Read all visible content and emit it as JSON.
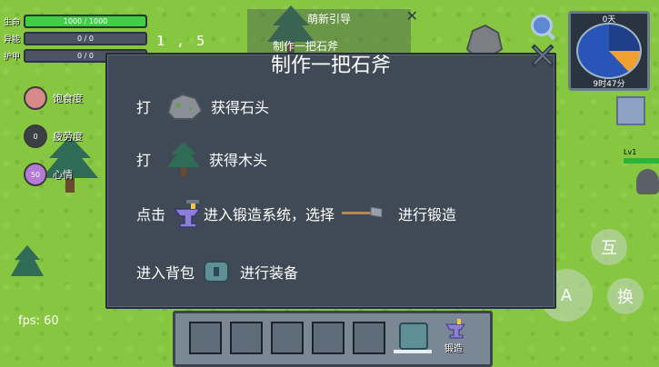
{
  "hud": {
    "hp_label": "生命",
    "hp_value": "1000 / 1000",
    "energy_label": "异能",
    "energy_value": "0 / 0",
    "armor_label": "护甲",
    "armor_value": "0 / 0",
    "coords": "1 , 5",
    "fps": "fps: 60"
  },
  "status": [
    {
      "label": "饱食度",
      "icon": "food-icon",
      "value": "",
      "color": "#d88a8a"
    },
    {
      "label": "疲劳度",
      "icon": "fatigue-icon",
      "value": "0",
      "color": "#3b3f46"
    },
    {
      "label": "心情",
      "icon": "mood-icon",
      "value": "50",
      "color": "#b47ad8"
    }
  ],
  "guide": {
    "title": "萌新引导",
    "task": "制作一把石斧"
  },
  "minimap": {
    "day": "0天",
    "time": "9时47分"
  },
  "enemy": {
    "level": "Lv1"
  },
  "dialog": {
    "title": "制作一把石斧",
    "row1": {
      "prefix": "打",
      "suffix": "获得石头"
    },
    "row2": {
      "prefix": "打",
      "suffix": "获得木头"
    },
    "row3": {
      "prefix": "点击",
      "middle": "进入锻造系统，选择",
      "suffix": "进行锻造"
    },
    "row4": {
      "prefix": "进入背包",
      "suffix": "进行装备"
    }
  },
  "buttons": {
    "interact": "互",
    "attack": "A",
    "swap": "换"
  },
  "hotbar": {
    "forge_label": "锻造"
  }
}
